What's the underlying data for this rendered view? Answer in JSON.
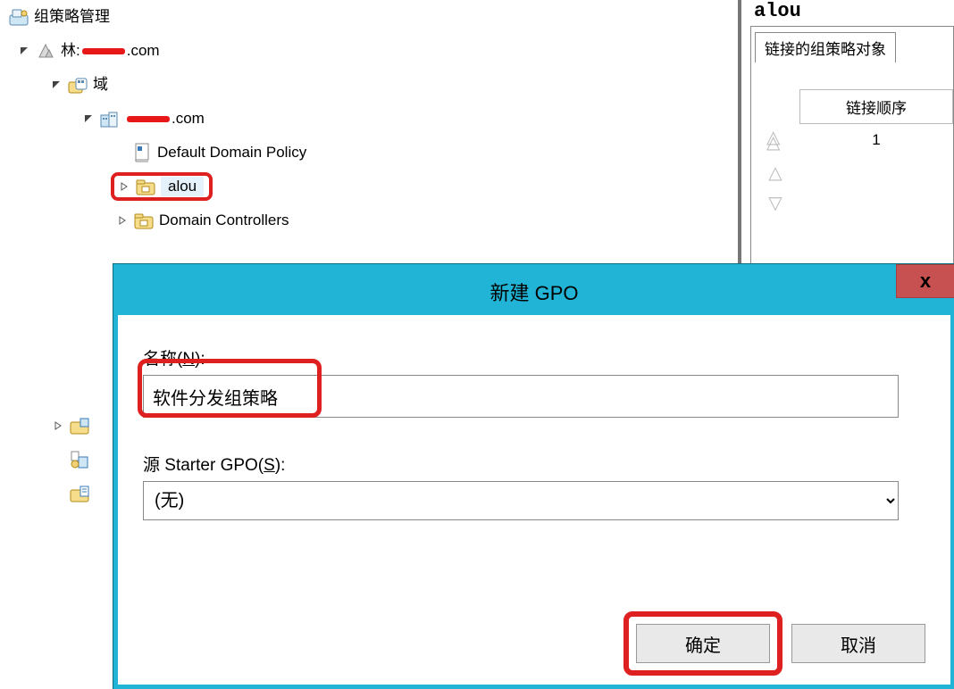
{
  "tree": {
    "title": "组策略管理",
    "forest_prefix": "林:",
    "forest_suffix": ".com",
    "domains_label": "域",
    "domain_suffix": ".com",
    "default_policy": "Default Domain Policy",
    "ou_alou": "alou",
    "ou_dc": "Domain Controllers"
  },
  "right": {
    "title": "alou",
    "tab": "链接的组策略对象",
    "col_header": "链接顺序",
    "row1": "1"
  },
  "dialog": {
    "title": "新建 GPO",
    "name_label_pre": "名称(",
    "name_label_u": "N",
    "name_label_post": "):",
    "name_value": "软件分发组策略",
    "src_label_pre": "源 Starter GPO(",
    "src_label_u": "S",
    "src_label_post": "):",
    "src_value": "(无)",
    "ok": "确定",
    "cancel": "取消",
    "close": "x"
  }
}
